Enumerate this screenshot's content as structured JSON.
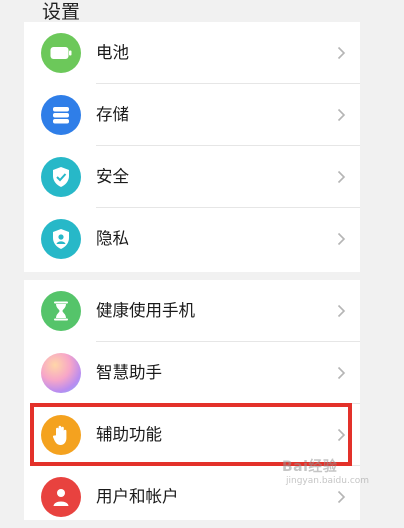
{
  "page": {
    "title": "设置"
  },
  "colors": {
    "battery": "#6cc85a",
    "storage": "#2f7ee8",
    "security": "#27b8c8",
    "privacy": "#27b8c8",
    "health": "#55c46a",
    "assistant": "#c98ae8",
    "accessibility": "#f4a21f",
    "account": "#e8423f",
    "highlight": "#e3312a"
  },
  "settings": {
    "group1": [
      {
        "label": "电池",
        "icon": "battery-icon"
      },
      {
        "label": "存储",
        "icon": "storage-icon"
      },
      {
        "label": "安全",
        "icon": "shield-icon"
      },
      {
        "label": "隐私",
        "icon": "privacy-icon"
      }
    ],
    "group2": [
      {
        "label": "健康使用手机",
        "icon": "hourglass-icon"
      },
      {
        "label": "智慧助手",
        "icon": "assistant-orb-icon"
      },
      {
        "label": "辅助功能",
        "icon": "hand-icon"
      },
      {
        "label": "用户和帐户",
        "icon": "user-icon"
      }
    ]
  },
  "watermark": {
    "text": "Bai经验",
    "sub": "jingyan.baidu.com"
  }
}
